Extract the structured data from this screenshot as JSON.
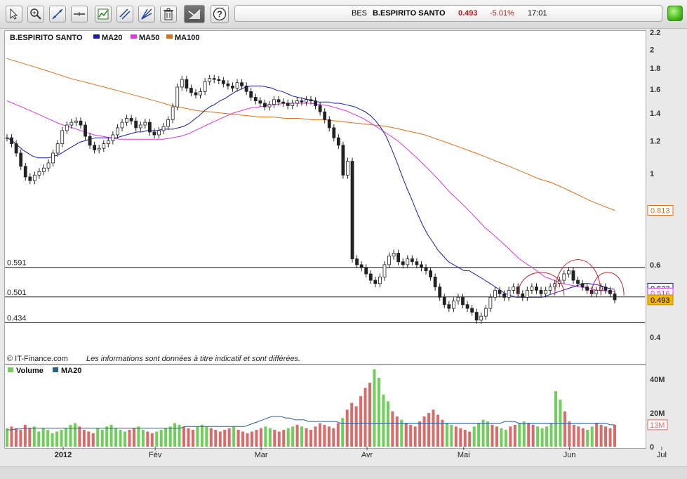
{
  "toolbar": {
    "tools": [
      "pointer-icon",
      "zoom-in-icon",
      "trendline-icon",
      "horizontal-line-icon",
      "indicators-icon",
      "parallel-lines-icon",
      "fan-lines-icon",
      "trash-icon",
      "chart-style-icon",
      "help-icon"
    ]
  },
  "ticker": {
    "symbol": "BES",
    "name": "B.ESPIRITO SANTO",
    "price": "0.493",
    "change": "-5.01%",
    "time": "17:01"
  },
  "colors": {
    "ma20": "#1a1aa8",
    "ma50": "#d93bd9",
    "ma100": "#d4731e",
    "candle_up": "#2b7a1e",
    "candle_down": "#b81e1e",
    "volume_up": "#6fcf5a",
    "volume_down": "#d96b6b",
    "annotation": "#c0272d",
    "price_box": "#f5b800"
  },
  "chart_data": [
    {
      "type": "candlestick",
      "title": "B.ESPIRITO SANTO",
      "legend": [
        "B.ESPIRITO SANTO",
        "MA20",
        "MA50",
        "MA100"
      ],
      "y_axis_ticks": [
        "2.2",
        "2",
        "1.8",
        "1.6",
        "1.4",
        "1.2",
        "1",
        "0.6",
        "0.4"
      ],
      "y_scale": "log",
      "ylim": [
        0.37,
        2.2
      ],
      "x_axis_ticks": [
        "2012",
        "Fév",
        "Mar",
        "Avr",
        "Mai",
        "Jun",
        "Jul"
      ],
      "horizontal_lines": [
        {
          "label": "0.591",
          "value": 0.591
        },
        {
          "label": "0.501",
          "value": 0.501
        },
        {
          "label": "0.434",
          "value": 0.434
        }
      ],
      "last_values": {
        "ma100": "0.813",
        "ma20": "0.523",
        "ma50": "0.516",
        "close": "0.493"
      },
      "footer": "© IT-Finance.com",
      "disclaimer": "Les informations sont données à titre indicatif et sont différées.",
      "closes": [
        1.22,
        1.18,
        1.12,
        1.04,
        0.98,
        0.96,
        0.99,
        1.01,
        1.03,
        1.06,
        1.12,
        1.18,
        1.27,
        1.31,
        1.33,
        1.34,
        1.31,
        1.23,
        1.17,
        1.14,
        1.15,
        1.18,
        1.2,
        1.24,
        1.29,
        1.33,
        1.36,
        1.34,
        1.29,
        1.31,
        1.33,
        1.26,
        1.24,
        1.27,
        1.3,
        1.35,
        1.45,
        1.62,
        1.69,
        1.61,
        1.57,
        1.55,
        1.58,
        1.67,
        1.7,
        1.69,
        1.68,
        1.65,
        1.63,
        1.61,
        1.66,
        1.63,
        1.58,
        1.53,
        1.5,
        1.48,
        1.45,
        1.47,
        1.51,
        1.49,
        1.48,
        1.46,
        1.48,
        1.5,
        1.49,
        1.51,
        1.5,
        1.46,
        1.41,
        1.35,
        1.29,
        1.22,
        1.17,
        0.99,
        1.07,
        0.62,
        0.6,
        0.59,
        0.57,
        0.55,
        0.54,
        0.56,
        0.6,
        0.63,
        0.64,
        0.61,
        0.6,
        0.62,
        0.61,
        0.6,
        0.59,
        0.58,
        0.56,
        0.53,
        0.5,
        0.48,
        0.47,
        0.49,
        0.5,
        0.48,
        0.47,
        0.46,
        0.44,
        0.45,
        0.47,
        0.5,
        0.52,
        0.51,
        0.5,
        0.52,
        0.53,
        0.51,
        0.5,
        0.52,
        0.53,
        0.52,
        0.51,
        0.52,
        0.53,
        0.54,
        0.55,
        0.57,
        0.58,
        0.55,
        0.54,
        0.53,
        0.52,
        0.51,
        0.52,
        0.53,
        0.52,
        0.51,
        0.493
      ],
      "ma20": [
        1.22,
        1.2,
        1.17,
        1.14,
        1.12,
        1.1,
        1.09,
        1.09,
        1.09,
        1.1,
        1.11,
        1.13,
        1.15,
        1.17,
        1.19,
        1.2,
        1.21,
        1.22,
        1.22,
        1.22,
        1.22,
        1.22,
        1.23,
        1.24,
        1.25,
        1.26,
        1.26,
        1.27,
        1.27,
        1.27,
        1.28,
        1.28,
        1.28,
        1.29,
        1.3,
        1.32,
        1.35,
        1.38,
        1.42,
        1.45,
        1.47,
        1.5,
        1.52,
        1.55,
        1.58,
        1.6,
        1.62,
        1.63,
        1.63,
        1.63,
        1.62,
        1.61,
        1.59,
        1.58,
        1.56,
        1.54,
        1.53,
        1.52,
        1.51,
        1.5,
        1.49,
        1.49,
        1.49,
        1.48,
        1.48,
        1.47,
        1.46,
        1.45,
        1.43,
        1.41,
        1.38,
        1.34,
        1.29,
        1.23,
        1.15,
        1.07,
        0.99,
        0.92,
        0.86,
        0.8,
        0.75,
        0.71,
        0.68,
        0.65,
        0.63,
        0.61,
        0.6,
        0.59,
        0.58,
        0.58,
        0.57,
        0.56,
        0.55,
        0.54,
        0.53,
        0.52,
        0.51,
        0.505,
        0.5,
        0.5,
        0.5,
        0.5,
        0.5,
        0.5,
        0.505,
        0.51,
        0.515,
        0.52,
        0.525,
        0.53,
        0.535,
        0.54,
        0.54,
        0.538,
        0.535,
        0.53,
        0.525,
        0.523
      ],
      "ma50": [
        1.5,
        1.47,
        1.44,
        1.41,
        1.38,
        1.35,
        1.32,
        1.3,
        1.28,
        1.26,
        1.24,
        1.23,
        1.22,
        1.21,
        1.21,
        1.21,
        1.21,
        1.21,
        1.21,
        1.22,
        1.23,
        1.25,
        1.28,
        1.31,
        1.34,
        1.37,
        1.4,
        1.42,
        1.44,
        1.45,
        1.46,
        1.47,
        1.48,
        1.48,
        1.48,
        1.48,
        1.47,
        1.46,
        1.44,
        1.42,
        1.39,
        1.36,
        1.32,
        1.28,
        1.24,
        1.2,
        1.15,
        1.1,
        1.05,
        1.0,
        0.95,
        0.9,
        0.86,
        0.82,
        0.78,
        0.74,
        0.71,
        0.68,
        0.65,
        0.62,
        0.6,
        0.58,
        0.56,
        0.55,
        0.54,
        0.535,
        0.53,
        0.525,
        0.52,
        0.518,
        0.516
      ],
      "ma100": [
        1.9,
        1.86,
        1.82,
        1.78,
        1.74,
        1.7,
        1.67,
        1.64,
        1.61,
        1.58,
        1.55,
        1.52,
        1.49,
        1.46,
        1.44,
        1.42,
        1.41,
        1.4,
        1.39,
        1.38,
        1.37,
        1.37,
        1.36,
        1.36,
        1.35,
        1.35,
        1.34,
        1.33,
        1.32,
        1.31,
        1.3,
        1.28,
        1.26,
        1.24,
        1.21,
        1.18,
        1.15,
        1.12,
        1.09,
        1.06,
        1.03,
        1.0,
        0.97,
        0.95,
        0.92,
        0.89,
        0.86,
        0.835,
        0.813
      ]
    },
    {
      "type": "bar",
      "title": "Volume",
      "legend": [
        "Volume",
        "MA20"
      ],
      "y_axis_ticks": [
        "40M",
        "20M",
        "0"
      ],
      "ylim": [
        0,
        48
      ],
      "last_value": "13M",
      "values": [
        11,
        12,
        11,
        10,
        13,
        11,
        12,
        9,
        11,
        10,
        8,
        9,
        10,
        11,
        13,
        14,
        12,
        10,
        9,
        8,
        11,
        10,
        12,
        13,
        11,
        10,
        9,
        10,
        11,
        12,
        10,
        9,
        8,
        9,
        10,
        11,
        12,
        14,
        13,
        12,
        11,
        10,
        12,
        13,
        12,
        11,
        10,
        9,
        10,
        11,
        12,
        10,
        9,
        8,
        9,
        10,
        11,
        12,
        11,
        10,
        9,
        10,
        11,
        12,
        13,
        12,
        11,
        10,
        12,
        14,
        13,
        12,
        11,
        14,
        17,
        22,
        26,
        24,
        30,
        35,
        38,
        46,
        41,
        31,
        27,
        21,
        18,
        16,
        14,
        13,
        12,
        15,
        18,
        20,
        22,
        19,
        16,
        14,
        13,
        12,
        11,
        10,
        9,
        12,
        14,
        16,
        15,
        13,
        12,
        11,
        10,
        12,
        13,
        14,
        15,
        14,
        13,
        12,
        11,
        12,
        14,
        33,
        28,
        21,
        15,
        13,
        12,
        11,
        10,
        12,
        14,
        13,
        12,
        11,
        13
      ],
      "ma20": [
        10,
        10,
        10.5,
        10.5,
        11,
        11,
        11,
        11,
        11,
        11,
        11,
        11,
        11,
        11,
        11,
        11,
        11,
        11,
        11,
        11,
        11,
        11,
        11,
        11,
        11,
        11,
        11,
        11,
        11,
        11,
        11,
        11,
        11,
        11,
        11,
        11,
        11,
        11,
        11,
        12,
        12,
        12,
        12,
        12,
        12,
        12,
        12,
        12,
        12,
        12,
        12,
        12,
        12,
        13,
        14,
        15,
        16,
        17,
        18,
        18,
        18,
        17,
        17,
        16,
        16,
        16,
        15,
        15,
        15,
        15,
        15,
        15,
        15,
        14,
        14,
        14,
        14,
        14,
        14,
        14,
        14,
        14,
        14,
        14,
        14,
        14,
        14,
        14,
        14,
        14,
        14,
        14,
        14,
        14,
        14,
        14,
        14,
        14,
        14,
        14,
        14,
        14,
        14,
        14,
        14,
        14,
        14,
        14,
        14,
        15,
        15,
        15,
        14,
        14,
        14,
        14,
        14,
        14,
        14,
        14,
        14,
        14,
        14,
        14,
        14,
        14,
        14,
        14,
        14,
        14,
        14,
        14,
        13,
        13
      ]
    }
  ]
}
